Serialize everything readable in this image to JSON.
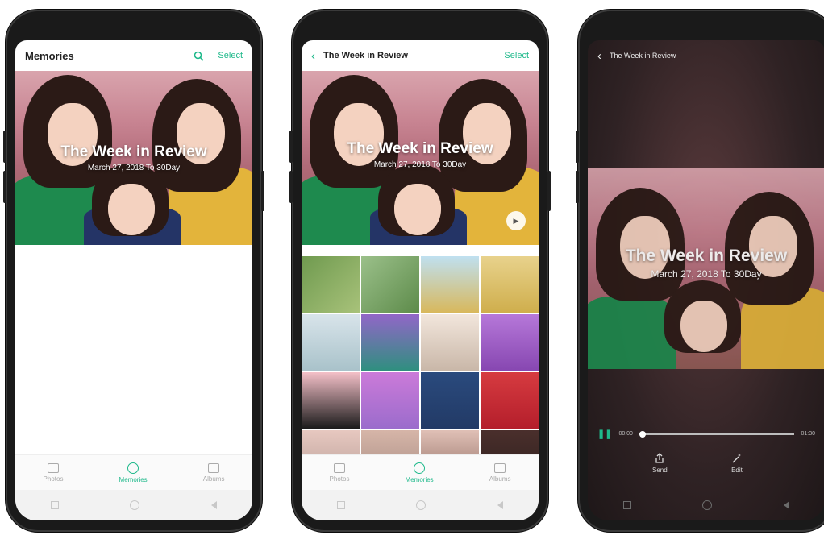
{
  "phone1": {
    "header_title": "Memories",
    "search_icon": "search-icon",
    "select_label": "Select",
    "cover_title": "The Week in Review",
    "cover_subtitle": "March 27, 2018 To 30Day",
    "tabs": [
      {
        "label": "Photos",
        "icon": "photos-icon"
      },
      {
        "label": "Memories",
        "icon": "memories-icon",
        "active": true
      },
      {
        "label": "Albums",
        "icon": "albums-icon"
      }
    ]
  },
  "phone2": {
    "back_icon": "chevron-left-icon",
    "header_title": "The Week in Review",
    "select_label": "Select",
    "cover_title": "The Week in Review",
    "cover_subtitle": "March 27, 2018 To 30Day",
    "play_icon": "play-icon",
    "tabs": [
      {
        "label": "Photos",
        "icon": "photos-icon"
      },
      {
        "label": "Memories",
        "icon": "memories-icon",
        "active": true
      },
      {
        "label": "Albums",
        "icon": "albums-icon"
      }
    ]
  },
  "phone3": {
    "back_icon": "chevron-left-icon",
    "header_title": "The Week in Review",
    "cover_title": "The Week in Review",
    "cover_subtitle": "March 27, 2018 To 30Day",
    "time_current": "00:00",
    "time_total": "01:30",
    "progress": 0.0,
    "actions": [
      {
        "label": "Send",
        "icon": "share-icon"
      },
      {
        "label": "Edit",
        "icon": "magic-wand-icon"
      }
    ]
  },
  "colors": {
    "accent": "#1fb98b",
    "dark_bg": "#2b2021"
  }
}
